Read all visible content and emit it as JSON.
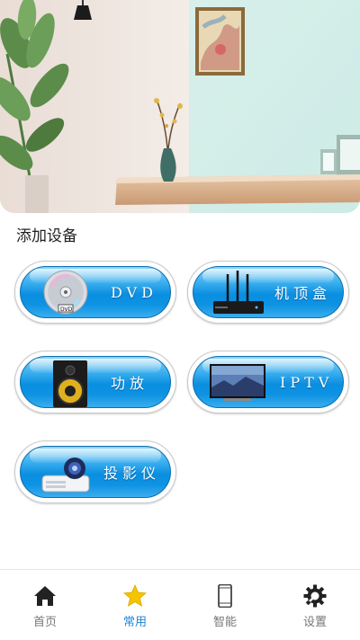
{
  "section": {
    "title": "添加设备"
  },
  "devices": [
    {
      "id": "dvd",
      "label": "DVD",
      "icon": "dvd-disc-icon"
    },
    {
      "id": "stb",
      "label": "机顶盒",
      "icon": "set-top-box-icon"
    },
    {
      "id": "amp",
      "label": "功放",
      "icon": "speaker-icon"
    },
    {
      "id": "iptv",
      "label": "IPTV",
      "icon": "tv-icon"
    },
    {
      "id": "proj",
      "label": "投影仪",
      "icon": "projector-icon"
    }
  ],
  "nav": {
    "items": [
      {
        "label": "首页",
        "icon": "home-icon",
        "active": false
      },
      {
        "label": "常用",
        "icon": "star-icon",
        "active": true
      },
      {
        "label": "智能",
        "icon": "phone-icon",
        "active": false
      },
      {
        "label": "设置",
        "icon": "gear-icon",
        "active": false
      }
    ]
  },
  "colors": {
    "accent": "#1f86d6",
    "button_blue": "#0a8ee0",
    "star": "#f5c400"
  }
}
